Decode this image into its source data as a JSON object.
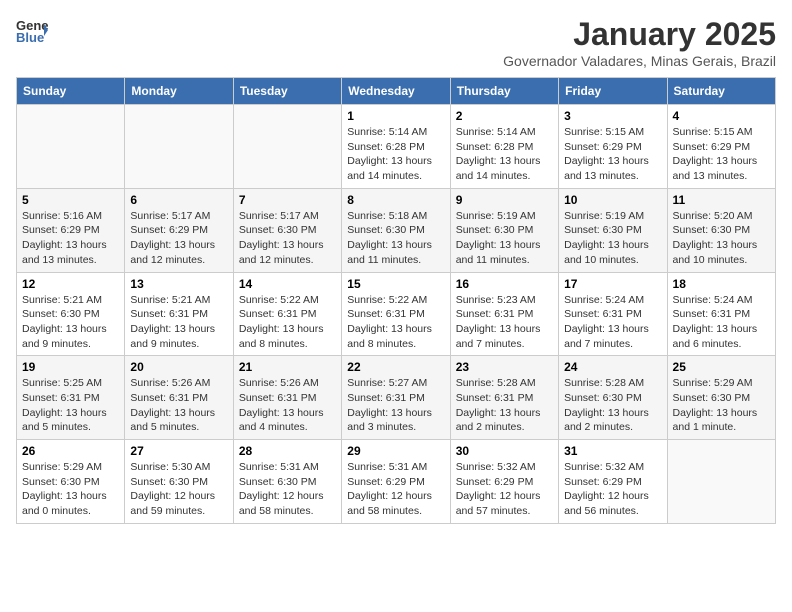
{
  "logo": {
    "line1": "General",
    "line2": "Blue"
  },
  "title": "January 2025",
  "subtitle": "Governador Valadares, Minas Gerais, Brazil",
  "days_of_week": [
    "Sunday",
    "Monday",
    "Tuesday",
    "Wednesday",
    "Thursday",
    "Friday",
    "Saturday"
  ],
  "weeks": [
    [
      {
        "day": "",
        "info": ""
      },
      {
        "day": "",
        "info": ""
      },
      {
        "day": "",
        "info": ""
      },
      {
        "day": "1",
        "info": "Sunrise: 5:14 AM\nSunset: 6:28 PM\nDaylight: 13 hours\nand 14 minutes."
      },
      {
        "day": "2",
        "info": "Sunrise: 5:14 AM\nSunset: 6:28 PM\nDaylight: 13 hours\nand 14 minutes."
      },
      {
        "day": "3",
        "info": "Sunrise: 5:15 AM\nSunset: 6:29 PM\nDaylight: 13 hours\nand 13 minutes."
      },
      {
        "day": "4",
        "info": "Sunrise: 5:15 AM\nSunset: 6:29 PM\nDaylight: 13 hours\nand 13 minutes."
      }
    ],
    [
      {
        "day": "5",
        "info": "Sunrise: 5:16 AM\nSunset: 6:29 PM\nDaylight: 13 hours\nand 13 minutes."
      },
      {
        "day": "6",
        "info": "Sunrise: 5:17 AM\nSunset: 6:29 PM\nDaylight: 13 hours\nand 12 minutes."
      },
      {
        "day": "7",
        "info": "Sunrise: 5:17 AM\nSunset: 6:30 PM\nDaylight: 13 hours\nand 12 minutes."
      },
      {
        "day": "8",
        "info": "Sunrise: 5:18 AM\nSunset: 6:30 PM\nDaylight: 13 hours\nand 11 minutes."
      },
      {
        "day": "9",
        "info": "Sunrise: 5:19 AM\nSunset: 6:30 PM\nDaylight: 13 hours\nand 11 minutes."
      },
      {
        "day": "10",
        "info": "Sunrise: 5:19 AM\nSunset: 6:30 PM\nDaylight: 13 hours\nand 10 minutes."
      },
      {
        "day": "11",
        "info": "Sunrise: 5:20 AM\nSunset: 6:30 PM\nDaylight: 13 hours\nand 10 minutes."
      }
    ],
    [
      {
        "day": "12",
        "info": "Sunrise: 5:21 AM\nSunset: 6:30 PM\nDaylight: 13 hours\nand 9 minutes."
      },
      {
        "day": "13",
        "info": "Sunrise: 5:21 AM\nSunset: 6:31 PM\nDaylight: 13 hours\nand 9 minutes."
      },
      {
        "day": "14",
        "info": "Sunrise: 5:22 AM\nSunset: 6:31 PM\nDaylight: 13 hours\nand 8 minutes."
      },
      {
        "day": "15",
        "info": "Sunrise: 5:22 AM\nSunset: 6:31 PM\nDaylight: 13 hours\nand 8 minutes."
      },
      {
        "day": "16",
        "info": "Sunrise: 5:23 AM\nSunset: 6:31 PM\nDaylight: 13 hours\nand 7 minutes."
      },
      {
        "day": "17",
        "info": "Sunrise: 5:24 AM\nSunset: 6:31 PM\nDaylight: 13 hours\nand 7 minutes."
      },
      {
        "day": "18",
        "info": "Sunrise: 5:24 AM\nSunset: 6:31 PM\nDaylight: 13 hours\nand 6 minutes."
      }
    ],
    [
      {
        "day": "19",
        "info": "Sunrise: 5:25 AM\nSunset: 6:31 PM\nDaylight: 13 hours\nand 5 minutes."
      },
      {
        "day": "20",
        "info": "Sunrise: 5:26 AM\nSunset: 6:31 PM\nDaylight: 13 hours\nand 5 minutes."
      },
      {
        "day": "21",
        "info": "Sunrise: 5:26 AM\nSunset: 6:31 PM\nDaylight: 13 hours\nand 4 minutes."
      },
      {
        "day": "22",
        "info": "Sunrise: 5:27 AM\nSunset: 6:31 PM\nDaylight: 13 hours\nand 3 minutes."
      },
      {
        "day": "23",
        "info": "Sunrise: 5:28 AM\nSunset: 6:31 PM\nDaylight: 13 hours\nand 2 minutes."
      },
      {
        "day": "24",
        "info": "Sunrise: 5:28 AM\nSunset: 6:30 PM\nDaylight: 13 hours\nand 2 minutes."
      },
      {
        "day": "25",
        "info": "Sunrise: 5:29 AM\nSunset: 6:30 PM\nDaylight: 13 hours\nand 1 minute."
      }
    ],
    [
      {
        "day": "26",
        "info": "Sunrise: 5:29 AM\nSunset: 6:30 PM\nDaylight: 13 hours\nand 0 minutes."
      },
      {
        "day": "27",
        "info": "Sunrise: 5:30 AM\nSunset: 6:30 PM\nDaylight: 12 hours\nand 59 minutes."
      },
      {
        "day": "28",
        "info": "Sunrise: 5:31 AM\nSunset: 6:30 PM\nDaylight: 12 hours\nand 58 minutes."
      },
      {
        "day": "29",
        "info": "Sunrise: 5:31 AM\nSunset: 6:29 PM\nDaylight: 12 hours\nand 58 minutes."
      },
      {
        "day": "30",
        "info": "Sunrise: 5:32 AM\nSunset: 6:29 PM\nDaylight: 12 hours\nand 57 minutes."
      },
      {
        "day": "31",
        "info": "Sunrise: 5:32 AM\nSunset: 6:29 PM\nDaylight: 12 hours\nand 56 minutes."
      },
      {
        "day": "",
        "info": ""
      }
    ]
  ]
}
